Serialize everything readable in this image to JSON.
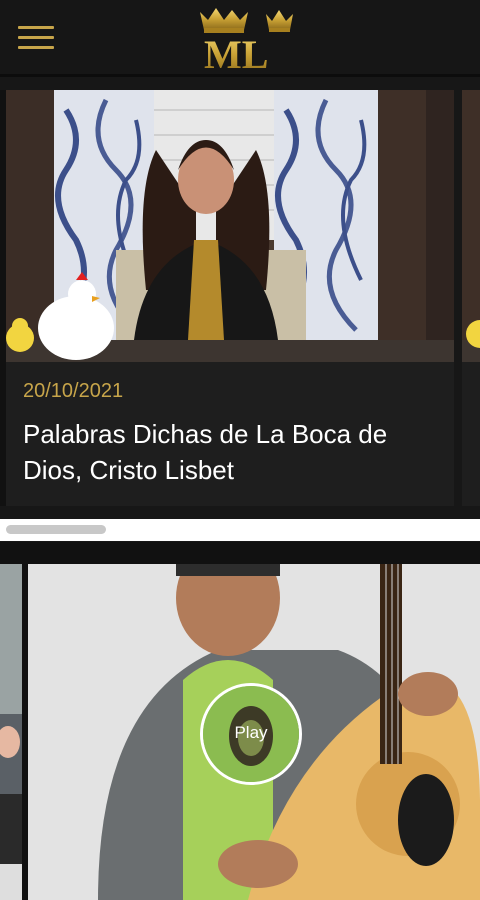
{
  "header": {
    "menu_icon": "hamburger-menu-icon",
    "logo_text": "ML",
    "logo_icon": "crown-icon"
  },
  "featured": {
    "date": "20/10/2021",
    "title": "Palabras Dichas de La Boca de Dios, Cristo Lisbet"
  },
  "second": {
    "play_label": "Play"
  },
  "colors": {
    "gold": "#c7a54a",
    "background": "#171717",
    "card": "#1e1e1e"
  }
}
